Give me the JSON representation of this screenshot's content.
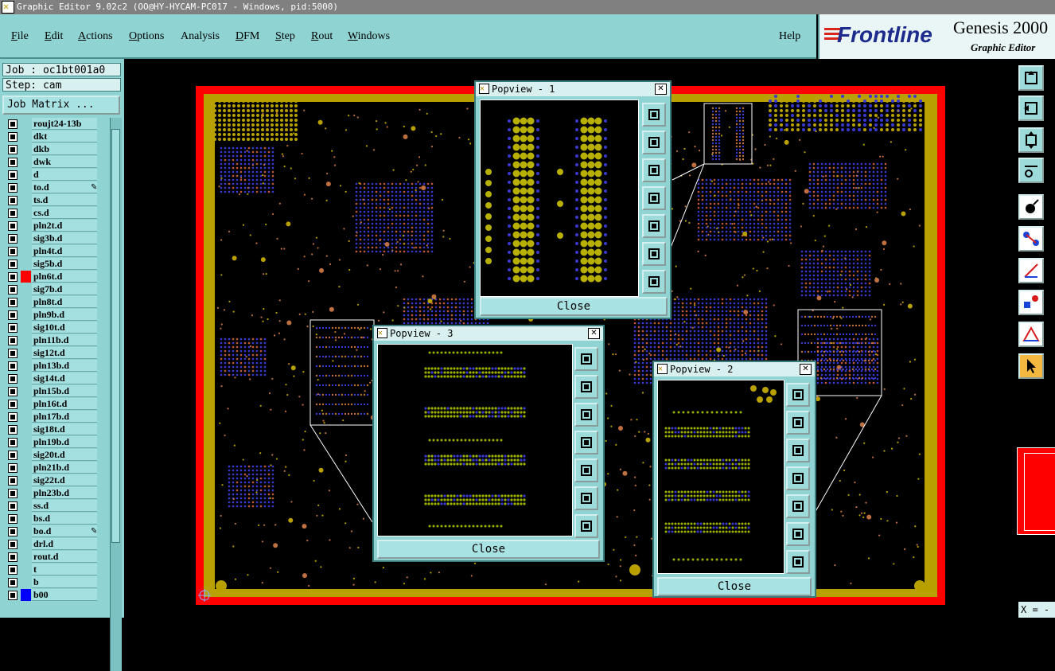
{
  "window": {
    "title": "Graphic Editor 9.02c2 (OO@HY-HYCAM-PC017 - Windows, pid:5000)"
  },
  "menu": [
    {
      "label": "File",
      "u": "F",
      "rest": "ile"
    },
    {
      "label": "Edit",
      "u": "E",
      "rest": "dit"
    },
    {
      "label": "Actions",
      "u": "A",
      "rest": "ctions"
    },
    {
      "label": "Options",
      "u": "O",
      "rest": "ptions"
    },
    {
      "label": "Analysis",
      "u": "",
      "rest": "Analysis"
    },
    {
      "label": "DFM",
      "u": "D",
      "rest": "FM"
    },
    {
      "label": "Step",
      "u": "S",
      "rest": "tep"
    },
    {
      "label": "Rout",
      "u": "R",
      "rest": "out"
    },
    {
      "label": "Windows",
      "u": "W",
      "rest": "indows"
    }
  ],
  "help": "Help",
  "brand": {
    "logo": "Frontline",
    "product": "Genesis 2000",
    "subtitle": "Graphic Editor"
  },
  "job": {
    "job_label": "Job : oc1bt001a0",
    "step_label": "Step: cam",
    "matrix_button": "Job Matrix ..."
  },
  "layers": [
    {
      "name": "roujt24-13b",
      "color": "",
      "marker": ""
    },
    {
      "name": "dkt",
      "color": "",
      "marker": ""
    },
    {
      "name": "dkb",
      "color": "",
      "marker": ""
    },
    {
      "name": "dwk",
      "color": "",
      "marker": ""
    },
    {
      "name": "d",
      "color": "",
      "marker": ""
    },
    {
      "name": "to.d",
      "color": "",
      "marker": "✎"
    },
    {
      "name": "ts.d",
      "color": "",
      "marker": ""
    },
    {
      "name": "cs.d",
      "color": "",
      "marker": ""
    },
    {
      "name": "pln2t.d",
      "color": "",
      "marker": ""
    },
    {
      "name": "sig3b.d",
      "color": "",
      "marker": ""
    },
    {
      "name": "pln4t.d",
      "color": "",
      "marker": ""
    },
    {
      "name": "sig5b.d",
      "color": "",
      "marker": ""
    },
    {
      "name": "pln6t.d",
      "color": "#ff0000",
      "marker": ""
    },
    {
      "name": "sig7b.d",
      "color": "",
      "marker": ""
    },
    {
      "name": "pln8t.d",
      "color": "",
      "marker": ""
    },
    {
      "name": "pln9b.d",
      "color": "",
      "marker": ""
    },
    {
      "name": "sig10t.d",
      "color": "",
      "marker": ""
    },
    {
      "name": "pln11b.d",
      "color": "",
      "marker": ""
    },
    {
      "name": "sig12t.d",
      "color": "",
      "marker": ""
    },
    {
      "name": "pln13b.d",
      "color": "",
      "marker": ""
    },
    {
      "name": "sig14t.d",
      "color": "",
      "marker": ""
    },
    {
      "name": "pln15b.d",
      "color": "",
      "marker": ""
    },
    {
      "name": "pln16t.d",
      "color": "",
      "marker": ""
    },
    {
      "name": "pln17b.d",
      "color": "",
      "marker": ""
    },
    {
      "name": "sig18t.d",
      "color": "",
      "marker": ""
    },
    {
      "name": "pln19b.d",
      "color": "",
      "marker": ""
    },
    {
      "name": "sig20t.d",
      "color": "",
      "marker": ""
    },
    {
      "name": "pln21b.d",
      "color": "",
      "marker": ""
    },
    {
      "name": "sig22t.d",
      "color": "",
      "marker": ""
    },
    {
      "name": "pln23b.d",
      "color": "",
      "marker": ""
    },
    {
      "name": "ss.d",
      "color": "",
      "marker": ""
    },
    {
      "name": "bs.d",
      "color": "",
      "marker": ""
    },
    {
      "name": "bo.d",
      "color": "",
      "marker": "✎"
    },
    {
      "name": "drl.d",
      "color": "",
      "marker": ""
    },
    {
      "name": "rout.d",
      "color": "",
      "marker": ""
    },
    {
      "name": "t",
      "color": "",
      "marker": ""
    },
    {
      "name": "b",
      "color": "",
      "marker": ""
    },
    {
      "name": "b00",
      "color": "#0000ff",
      "marker": ""
    }
  ],
  "popviews": [
    {
      "title": "Popview - 1",
      "close": "Close"
    },
    {
      "title": "Popview - 3",
      "close": "Close"
    },
    {
      "title": "Popview - 2",
      "close": "Close"
    }
  ],
  "coord_readout": "X = -",
  "colors": {
    "panel": "#8fd3d3",
    "board_outline": "#ff0000",
    "copper": "#b8a000",
    "pads_blue": "#3a3ad0"
  }
}
